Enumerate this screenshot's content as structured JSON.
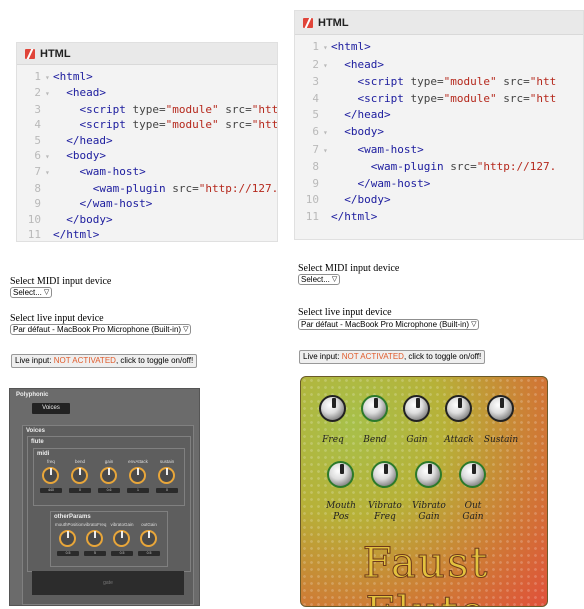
{
  "code_tab_label": "HTML",
  "left_code": [
    {
      "n": "1",
      "fold": true,
      "parts": [
        [
          "tag",
          "<html>"
        ]
      ]
    },
    {
      "n": "2",
      "fold": true,
      "parts": [
        [
          "sp",
          "  "
        ],
        [
          "tag",
          "<head>"
        ]
      ]
    },
    {
      "n": "3",
      "fold": false,
      "parts": [
        [
          "sp",
          "    "
        ],
        [
          "tag",
          "<script "
        ],
        [
          "attr",
          "type="
        ],
        [
          "str",
          "\"module\""
        ],
        [
          "attr",
          " src="
        ],
        [
          "str",
          "\"htt"
        ]
      ]
    },
    {
      "n": "4",
      "fold": false,
      "parts": [
        [
          "sp",
          "    "
        ],
        [
          "tag",
          "<script "
        ],
        [
          "attr",
          "type="
        ],
        [
          "str",
          "\"module\""
        ],
        [
          "attr",
          " src="
        ],
        [
          "str",
          "\"htt"
        ]
      ]
    },
    {
      "n": "5",
      "fold": false,
      "parts": [
        [
          "sp",
          "  "
        ],
        [
          "tag",
          "</head>"
        ]
      ]
    },
    {
      "n": "6",
      "fold": true,
      "parts": [
        [
          "sp",
          "  "
        ],
        [
          "tag",
          "<body>"
        ]
      ]
    },
    {
      "n": "7",
      "fold": true,
      "parts": [
        [
          "sp",
          "    "
        ],
        [
          "tag",
          "<wam-host>"
        ]
      ]
    },
    {
      "n": "8",
      "fold": false,
      "parts": [
        [
          "sp",
          "      "
        ],
        [
          "tag",
          "<wam-plugin "
        ],
        [
          "attr",
          "src="
        ],
        [
          "str",
          "\"http://127."
        ]
      ]
    },
    {
      "n": "9",
      "fold": false,
      "parts": [
        [
          "sp",
          "    "
        ],
        [
          "tag",
          "</wam-host>"
        ]
      ]
    },
    {
      "n": "10",
      "fold": false,
      "parts": [
        [
          "sp",
          "  "
        ],
        [
          "tag",
          "</body>"
        ]
      ]
    },
    {
      "n": "11",
      "fold": false,
      "parts": [
        [
          "tag",
          "</html>"
        ]
      ]
    }
  ],
  "right_code": [
    {
      "n": "1",
      "fold": true,
      "parts": [
        [
          "tag",
          "<html>"
        ]
      ]
    },
    {
      "n": "2",
      "fold": true,
      "parts": [
        [
          "sp",
          "  "
        ],
        [
          "tag",
          "<head>"
        ]
      ]
    },
    {
      "n": "3",
      "fold": false,
      "parts": [
        [
          "sp",
          "    "
        ],
        [
          "tag",
          "<script "
        ],
        [
          "attr",
          "type="
        ],
        [
          "str",
          "\"module\""
        ],
        [
          "attr",
          " src="
        ],
        [
          "str",
          "\"htt"
        ]
      ]
    },
    {
      "n": "4",
      "fold": false,
      "parts": [
        [
          "sp",
          "    "
        ],
        [
          "tag",
          "<script "
        ],
        [
          "attr",
          "type="
        ],
        [
          "str",
          "\"module\""
        ],
        [
          "attr",
          " src="
        ],
        [
          "str",
          "\"htt"
        ]
      ]
    },
    {
      "n": "5",
      "fold": false,
      "parts": [
        [
          "sp",
          "  "
        ],
        [
          "tag",
          "</head>"
        ]
      ]
    },
    {
      "n": "6",
      "fold": true,
      "parts": [
        [
          "sp",
          "  "
        ],
        [
          "tag",
          "<body>"
        ]
      ]
    },
    {
      "n": "7",
      "fold": true,
      "parts": [
        [
          "sp",
          "    "
        ],
        [
          "tag",
          "<wam-host>"
        ]
      ]
    },
    {
      "n": "8",
      "fold": false,
      "parts": [
        [
          "sp",
          "      "
        ],
        [
          "tag",
          "<wam-plugin "
        ],
        [
          "attr",
          "src="
        ],
        [
          "str",
          "\"http://127."
        ]
      ]
    },
    {
      "n": "9",
      "fold": false,
      "parts": [
        [
          "sp",
          "    "
        ],
        [
          "tag",
          "</wam-host>"
        ]
      ]
    },
    {
      "n": "10",
      "fold": false,
      "parts": [
        [
          "sp",
          "  "
        ],
        [
          "tag",
          "</body>"
        ]
      ]
    },
    {
      "n": "11",
      "fold": false,
      "parts": [
        [
          "tag",
          "</html>"
        ]
      ]
    }
  ],
  "controls": {
    "midi_label": "Select MIDI input device",
    "midi_value": "Select...",
    "live_label": "Select live input device",
    "live_value": "Par défaut - MacBook Pro Microphone (Built-in)",
    "toggle_prefix": "Live input: ",
    "toggle_status": "NOT ACTIVATED",
    "toggle_suffix": ", click to toggle on/off!"
  },
  "poly": {
    "title": "Polyphonic",
    "voices_btn": "Voices",
    "voices_header": "Voices",
    "flute": "flute",
    "midi": "midi",
    "midi_knobs": [
      {
        "label": "freq",
        "value": "440"
      },
      {
        "label": "bend",
        "value": "0"
      },
      {
        "label": "gain",
        "value": "0.6"
      },
      {
        "label": "envAttack",
        "value": "1"
      },
      {
        "label": "sustain",
        "value": "0"
      }
    ],
    "other": "otherParams",
    "other_knobs": [
      {
        "label": "mouthPosition",
        "value": "0.5"
      },
      {
        "label": "vibratoFreq",
        "value": "5"
      },
      {
        "label": "vibratoGain",
        "value": "0.5"
      },
      {
        "label": "outGain",
        "value": "0.5"
      }
    ],
    "gate": "gate"
  },
  "flute": {
    "title": "Faust Flute",
    "row1": [
      "Freq",
      "Bend",
      "Gain",
      "Attack",
      "Sustain"
    ],
    "row2": [
      [
        "Mouth",
        "Pos"
      ],
      [
        "Vibrato",
        "Freq"
      ],
      [
        "Vibrato",
        "Gain"
      ],
      [
        "Out",
        "Gain"
      ]
    ]
  }
}
